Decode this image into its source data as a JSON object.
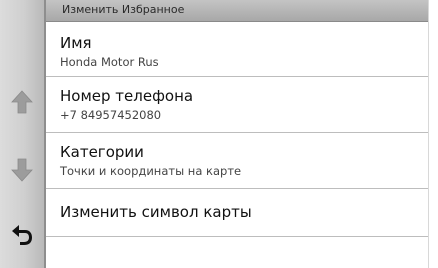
{
  "header": {
    "title": "Изменить Избранное"
  },
  "items": [
    {
      "label": "Имя",
      "value": "Honda Motor Rus"
    },
    {
      "label": "Номер телефона",
      "value": "+7 84957452080"
    },
    {
      "label": "Категории",
      "value": "Точки и координаты на карте"
    },
    {
      "label": "Изменить символ карты"
    }
  ],
  "sidebar": {
    "up_icon": "arrow-up-icon",
    "down_icon": "arrow-down-icon",
    "back_icon": "back-icon"
  },
  "colors": {
    "sidebar": "#cfcfcf",
    "title_bar": "#b5b5b5",
    "arrow": "#9a9a9a",
    "back_arrow": "#111111"
  }
}
